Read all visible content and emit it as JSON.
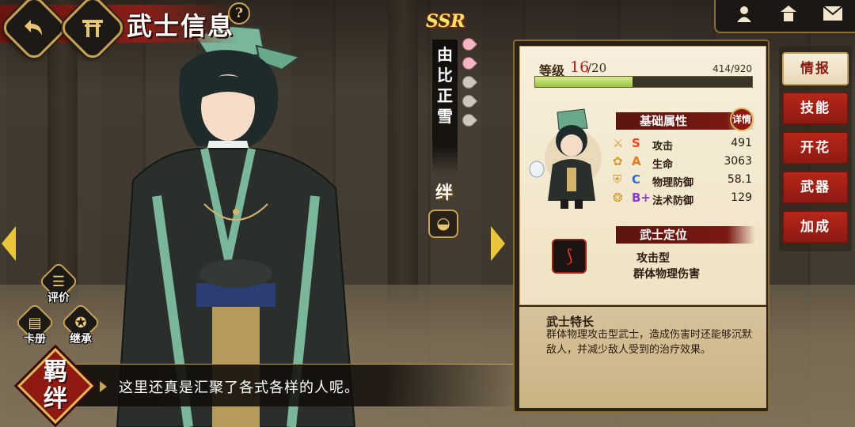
{
  "header": {
    "title": "武士信息",
    "help_glyph": "?",
    "back_icon": "back-arrow-icon",
    "home_icon": "torii-gate-icon"
  },
  "top_right_icons": [
    "character-icon",
    "shrine-icon",
    "mail-icon"
  ],
  "character": {
    "rarity": "SSR",
    "name": "由比正雪",
    "star_petals": {
      "filled": 2,
      "total": 5
    },
    "bond_char": "绊",
    "bond_badge_glyph": "👛"
  },
  "left_buttons": {
    "evaluate_label": "评价",
    "card_album_label": "卡册",
    "inherit_label": "继承"
  },
  "bond_emblem": {
    "line1": "羁",
    "line2": "绊"
  },
  "dialog": {
    "text": "这里还真是汇聚了各式各样的人呢。"
  },
  "info": {
    "level_label": "等级",
    "level_current": "16",
    "level_max": "/20",
    "exp_text": "414/920",
    "exp_progress": 0.45,
    "basic_attrs_title": "基础属性",
    "detail_badge": "详情",
    "stats": [
      {
        "icon": "sword-icon",
        "grade": "S",
        "grade_color": "#e0451a",
        "name": "攻击",
        "value": "491"
      },
      {
        "icon": "heart-flower-icon",
        "grade": "A",
        "grade_color": "#e07a1a",
        "name": "生命",
        "value": "3063"
      },
      {
        "icon": "armor-icon",
        "grade": "C",
        "grade_color": "#2a6fd0",
        "name": "物理防御",
        "value": "58.1"
      },
      {
        "icon": "magic-shield-icon",
        "grade": "B+",
        "grade_color": "#8a3ac8",
        "name": "法术防御",
        "value": "129"
      }
    ],
    "role_title": "武士定位",
    "role_lines": [
      "攻击型",
      "群体物理伤害"
    ],
    "trait_title": "武士特长",
    "trait_body": "群体物理攻击型武士，造成伤害时还能够沉默敌人，并减少敌人受到的治疗效果。"
  },
  "tabs": [
    {
      "label": "情报",
      "active": true
    },
    {
      "label": "技能",
      "active": false
    },
    {
      "label": "开花",
      "active": false
    },
    {
      "label": "武器",
      "active": false
    },
    {
      "label": "加成",
      "active": false
    }
  ],
  "colors": {
    "accent_red": "#8e1a12",
    "gold": "#c8a256",
    "level_red": "#b51c12",
    "exp_green": "#9cc248"
  }
}
